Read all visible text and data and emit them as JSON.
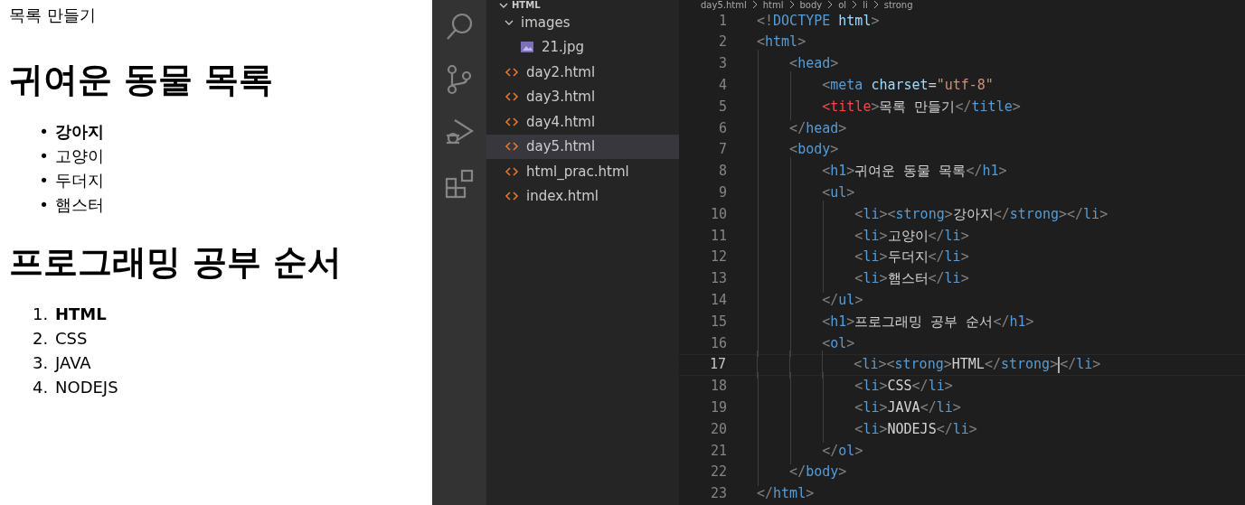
{
  "preview": {
    "page_title": "목록 만들기",
    "sections": [
      {
        "heading": "귀여운 동물 목록",
        "items": [
          {
            "text": "강아지",
            "bold": true,
            "marker": "•"
          },
          {
            "text": "고양이",
            "bold": false,
            "marker": "•"
          },
          {
            "text": "두더지",
            "bold": false,
            "marker": "•"
          },
          {
            "text": "햄스터",
            "bold": false,
            "marker": "•"
          }
        ]
      },
      {
        "heading": "프로그래밍 공부 순서",
        "items": [
          {
            "text": "HTML",
            "bold": true,
            "marker": "1."
          },
          {
            "text": "CSS",
            "bold": false,
            "marker": "2."
          },
          {
            "text": "JAVA",
            "bold": false,
            "marker": "3."
          },
          {
            "text": "NODEJS",
            "bold": false,
            "marker": "4."
          }
        ]
      }
    ]
  },
  "explorer": {
    "header": {
      "label": "HTML",
      "expanded": true
    },
    "items": [
      {
        "label": "images",
        "kind": "folder",
        "expanded": true,
        "selected": false,
        "children": [
          {
            "label": "21.jpg",
            "kind": "image",
            "selected": false
          }
        ]
      },
      {
        "label": "day2.html",
        "kind": "html",
        "selected": false
      },
      {
        "label": "day3.html",
        "kind": "html",
        "selected": false
      },
      {
        "label": "day4.html",
        "kind": "html",
        "selected": false
      },
      {
        "label": "day5.html",
        "kind": "html",
        "selected": true
      },
      {
        "label": "html_prac.html",
        "kind": "html",
        "selected": false
      },
      {
        "label": "index.html",
        "kind": "html",
        "selected": false
      }
    ]
  },
  "editor": {
    "breadcrumb": [
      "day5.html",
      "html",
      "body",
      "ol",
      "li",
      "strong"
    ],
    "lines": [
      {
        "number": "1",
        "current": false,
        "tokens": [
          {
            "kind": "punct",
            "text": "<!"
          },
          {
            "kind": "tag",
            "text": "DOCTYPE"
          },
          {
            "kind": "attr",
            "text": " html"
          },
          {
            "kind": "punct",
            "text": ">"
          }
        ]
      },
      {
        "number": "2",
        "current": false,
        "tokens": [
          {
            "kind": "punct",
            "text": "<"
          },
          {
            "kind": "tag",
            "text": "html"
          },
          {
            "kind": "punct",
            "text": ">"
          }
        ]
      },
      {
        "number": "3",
        "current": false,
        "tokens": [
          {
            "kind": "punct",
            "text": "    <"
          },
          {
            "kind": "tag",
            "text": "head"
          },
          {
            "kind": "punct",
            "text": ">"
          }
        ]
      },
      {
        "number": "4",
        "current": false,
        "tokens": [
          {
            "kind": "punct",
            "text": "        <"
          },
          {
            "kind": "tag",
            "text": "meta"
          },
          {
            "kind": "attr",
            "text": " charset"
          },
          {
            "kind": "text",
            "text": "="
          },
          {
            "kind": "string",
            "text": "\"utf-8\""
          }
        ]
      },
      {
        "number": "5",
        "current": false,
        "tokens": [
          {
            "kind": "error",
            "text": "        <title"
          },
          {
            "kind": "punct",
            "text": ">"
          },
          {
            "kind": "text",
            "text": "목록 만들기"
          },
          {
            "kind": "punct",
            "text": "</"
          },
          {
            "kind": "tag",
            "text": "title"
          },
          {
            "kind": "punct",
            "text": ">"
          }
        ]
      },
      {
        "number": "6",
        "current": false,
        "tokens": [
          {
            "kind": "punct",
            "text": "    </"
          },
          {
            "kind": "tag",
            "text": "head"
          },
          {
            "kind": "punct",
            "text": ">"
          }
        ]
      },
      {
        "number": "7",
        "current": false,
        "tokens": [
          {
            "kind": "punct",
            "text": "    <"
          },
          {
            "kind": "tag",
            "text": "body"
          },
          {
            "kind": "punct",
            "text": ">"
          }
        ]
      },
      {
        "number": "8",
        "current": false,
        "tokens": [
          {
            "kind": "punct",
            "text": "        <"
          },
          {
            "kind": "tag",
            "text": "h1"
          },
          {
            "kind": "punct",
            "text": ">"
          },
          {
            "kind": "text",
            "text": "귀여운 동물 목록"
          },
          {
            "kind": "punct",
            "text": "</"
          },
          {
            "kind": "tag",
            "text": "h1"
          },
          {
            "kind": "punct",
            "text": ">"
          }
        ]
      },
      {
        "number": "9",
        "current": false,
        "tokens": [
          {
            "kind": "punct",
            "text": "        <"
          },
          {
            "kind": "tag",
            "text": "ul"
          },
          {
            "kind": "punct",
            "text": ">"
          }
        ]
      },
      {
        "number": "10",
        "current": false,
        "tokens": [
          {
            "kind": "punct",
            "text": "            <"
          },
          {
            "kind": "tag",
            "text": "li"
          },
          {
            "kind": "punct",
            "text": "><"
          },
          {
            "kind": "tag",
            "text": "strong"
          },
          {
            "kind": "punct",
            "text": ">"
          },
          {
            "kind": "text",
            "text": "강아지"
          },
          {
            "kind": "punct",
            "text": "</"
          },
          {
            "kind": "tag",
            "text": "strong"
          },
          {
            "kind": "punct",
            "text": "></"
          },
          {
            "kind": "tag",
            "text": "li"
          },
          {
            "kind": "punct",
            "text": ">"
          }
        ]
      },
      {
        "number": "11",
        "current": false,
        "tokens": [
          {
            "kind": "punct",
            "text": "            <"
          },
          {
            "kind": "tag",
            "text": "li"
          },
          {
            "kind": "punct",
            "text": ">"
          },
          {
            "kind": "text",
            "text": "고양이"
          },
          {
            "kind": "punct",
            "text": "</"
          },
          {
            "kind": "tag",
            "text": "li"
          },
          {
            "kind": "punct",
            "text": ">"
          }
        ]
      },
      {
        "number": "12",
        "current": false,
        "tokens": [
          {
            "kind": "punct",
            "text": "            <"
          },
          {
            "kind": "tag",
            "text": "li"
          },
          {
            "kind": "punct",
            "text": ">"
          },
          {
            "kind": "text",
            "text": "두더지"
          },
          {
            "kind": "punct",
            "text": "</"
          },
          {
            "kind": "tag",
            "text": "li"
          },
          {
            "kind": "punct",
            "text": ">"
          }
        ]
      },
      {
        "number": "13",
        "current": false,
        "tokens": [
          {
            "kind": "punct",
            "text": "            <"
          },
          {
            "kind": "tag",
            "text": "li"
          },
          {
            "kind": "punct",
            "text": ">"
          },
          {
            "kind": "text",
            "text": "햄스터"
          },
          {
            "kind": "punct",
            "text": "</"
          },
          {
            "kind": "tag",
            "text": "li"
          },
          {
            "kind": "punct",
            "text": ">"
          }
        ]
      },
      {
        "number": "14",
        "current": false,
        "tokens": [
          {
            "kind": "punct",
            "text": "        </"
          },
          {
            "kind": "tag",
            "text": "ul"
          },
          {
            "kind": "punct",
            "text": ">"
          }
        ]
      },
      {
        "number": "15",
        "current": false,
        "tokens": [
          {
            "kind": "punct",
            "text": "        <"
          },
          {
            "kind": "tag",
            "text": "h1"
          },
          {
            "kind": "punct",
            "text": ">"
          },
          {
            "kind": "text",
            "text": "프로그래밍 공부 순서"
          },
          {
            "kind": "punct",
            "text": "</"
          },
          {
            "kind": "tag",
            "text": "h1"
          },
          {
            "kind": "punct",
            "text": ">"
          }
        ]
      },
      {
        "number": "16",
        "current": false,
        "tokens": [
          {
            "kind": "punct",
            "text": "        <"
          },
          {
            "kind": "tag",
            "text": "ol"
          },
          {
            "kind": "punct",
            "text": ">"
          }
        ]
      },
      {
        "number": "17",
        "current": true,
        "tokens": [
          {
            "kind": "punct",
            "text": "            <"
          },
          {
            "kind": "tag",
            "text": "li"
          },
          {
            "kind": "punct",
            "text": "><"
          },
          {
            "kind": "tag",
            "text": "strong"
          },
          {
            "kind": "punct",
            "text": ">"
          },
          {
            "kind": "text",
            "text": "HTML"
          },
          {
            "kind": "punct",
            "text": "</"
          },
          {
            "kind": "tag",
            "text": "strong"
          },
          {
            "kind": "punct",
            "text": ">"
          },
          {
            "kind": "cursor"
          },
          {
            "kind": "punct",
            "text": "</"
          },
          {
            "kind": "tag",
            "text": "li"
          },
          {
            "kind": "punct",
            "text": ">"
          }
        ]
      },
      {
        "number": "18",
        "current": false,
        "tokens": [
          {
            "kind": "punct",
            "text": "            <"
          },
          {
            "kind": "tag",
            "text": "li"
          },
          {
            "kind": "punct",
            "text": ">"
          },
          {
            "kind": "text",
            "text": "CSS"
          },
          {
            "kind": "punct",
            "text": "</"
          },
          {
            "kind": "tag",
            "text": "li"
          },
          {
            "kind": "punct",
            "text": ">"
          }
        ]
      },
      {
        "number": "19",
        "current": false,
        "tokens": [
          {
            "kind": "punct",
            "text": "            <"
          },
          {
            "kind": "tag",
            "text": "li"
          },
          {
            "kind": "punct",
            "text": ">"
          },
          {
            "kind": "text",
            "text": "JAVA"
          },
          {
            "kind": "punct",
            "text": "</"
          },
          {
            "kind": "tag",
            "text": "li"
          },
          {
            "kind": "punct",
            "text": ">"
          }
        ]
      },
      {
        "number": "20",
        "current": false,
        "tokens": [
          {
            "kind": "punct",
            "text": "            <"
          },
          {
            "kind": "tag",
            "text": "li"
          },
          {
            "kind": "punct",
            "text": ">"
          },
          {
            "kind": "text",
            "text": "NODEJS"
          },
          {
            "kind": "punct",
            "text": "</"
          },
          {
            "kind": "tag",
            "text": "li"
          },
          {
            "kind": "punct",
            "text": ">"
          }
        ]
      },
      {
        "number": "21",
        "current": false,
        "tokens": [
          {
            "kind": "punct",
            "text": "        </"
          },
          {
            "kind": "tag",
            "text": "ol"
          },
          {
            "kind": "punct",
            "text": ">"
          }
        ]
      },
      {
        "number": "22",
        "current": false,
        "tokens": [
          {
            "kind": "punct",
            "text": "    </"
          },
          {
            "kind": "tag",
            "text": "body"
          },
          {
            "kind": "punct",
            "text": ">"
          }
        ]
      },
      {
        "number": "23",
        "current": false,
        "tokens": [
          {
            "kind": "punct",
            "text": "</"
          },
          {
            "kind": "tag",
            "text": "html"
          },
          {
            "kind": "punct",
            "text": ">"
          }
        ]
      }
    ]
  }
}
